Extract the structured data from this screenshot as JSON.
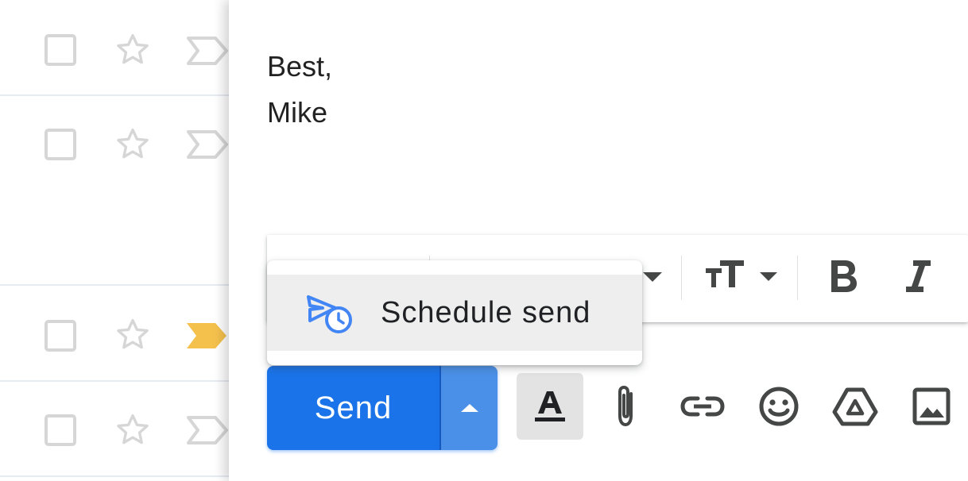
{
  "colors": {
    "send_blue": "#1a73e8",
    "send_more_blue": "#4a90e8",
    "schedule_icon_blue": "#4285f4",
    "important_yellow": "#f5c14d",
    "icon_gray": "#444746",
    "light_gray": "#d6d6d6"
  },
  "inbox": {
    "rows": [
      {
        "checkbox_icon": "checkbox-icon",
        "star_icon": "star-outline-icon",
        "importance_icon": "importance-marker-outline-icon",
        "important": false
      },
      {
        "checkbox_icon": "checkbox-icon",
        "star_icon": "star-outline-icon",
        "importance_icon": "importance-marker-outline-icon",
        "important": false
      },
      {
        "checkbox_icon": "checkbox-icon",
        "star_icon": "star-outline-icon",
        "importance_icon": "importance-marker-filled-icon",
        "important": true
      },
      {
        "checkbox_icon": "checkbox-icon",
        "star_icon": "star-outline-icon",
        "importance_icon": "importance-marker-outline-icon",
        "important": false
      }
    ]
  },
  "compose": {
    "signature_lines": [
      "Best,",
      "Mike"
    ],
    "format_toolbar": {
      "icons": [
        "chevron-down-icon",
        "text-size-icon",
        "bold-icon",
        "italic-icon"
      ]
    },
    "send_label": "Send",
    "send_options_icon": "caret-up-icon",
    "bottom_icons": [
      "text-color-icon",
      "attach-icon",
      "link-icon",
      "emoji-icon",
      "drive-icon",
      "photo-icon"
    ]
  },
  "popup": {
    "item_label": "Schedule send",
    "item_icon": "schedule-send-icon"
  }
}
